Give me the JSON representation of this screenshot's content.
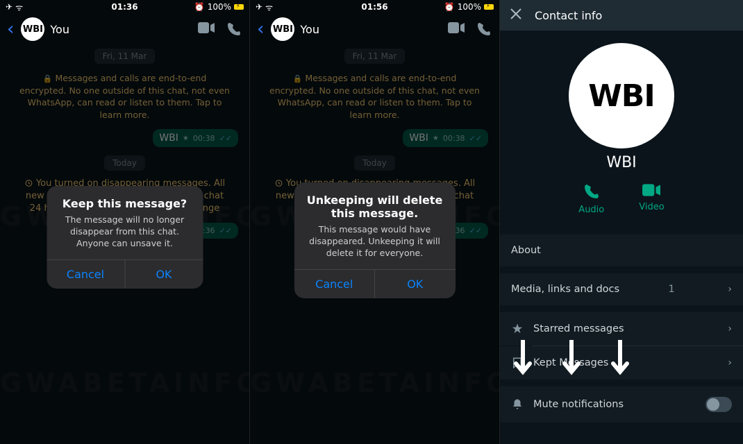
{
  "panel1": {
    "status": {
      "time": "01:36",
      "battery": "100%",
      "alarm": "⏰"
    },
    "header": {
      "name": "You"
    },
    "date": "Fri, 11 Mar",
    "encryption": "Messages and calls are end-to-end encrypted. No one outside of this chat, not even WhatsApp, can read or listen to them. Tap to learn more.",
    "msg": {
      "text": "WBI",
      "time": "00:38"
    },
    "today": "Today",
    "system": "You turned on disappearing messages. All new messages will disappear from this chat 24 hours after they're sent. Tap to change",
    "msg2time": "01:36",
    "dialog": {
      "title": "Keep this message?",
      "body": "The message will no longer disappear from this chat. Anyone can unsave it.",
      "cancel": "Cancel",
      "ok": "OK"
    }
  },
  "panel2": {
    "status": {
      "time": "01:56",
      "battery": "100%",
      "alarm": "⏰"
    },
    "header": {
      "name": "You"
    },
    "date": "Fri, 11 Mar",
    "encryption": "Messages and calls are end-to-end encrypted. No one outside of this chat, not even WhatsApp, can read or listen to them. Tap to learn more.",
    "msg": {
      "text": "WBI",
      "time": "00:38"
    },
    "today": "Today",
    "system": "You turned on disappearing messages. All new messages will disappear from this chat 24 hours",
    "msg2time": "01:36",
    "dialog": {
      "title": "Unkeeping will delete this message.",
      "body": "This message would have disappeared. Unkeeping it will delete it for everyone.",
      "cancel": "Cancel",
      "ok": "OK"
    }
  },
  "panel3": {
    "title": "Contact info",
    "avatar": "WBI",
    "name": "WBI",
    "audio": "Audio",
    "video": "Video",
    "about": "About",
    "media": "Media, links and docs",
    "mediaCount": "1",
    "starred": "Starred messages",
    "kept": "Kept Messages",
    "mute": "Mute notifications"
  },
  "avatar": "WBI",
  "watermark": "GWABETAINFO"
}
